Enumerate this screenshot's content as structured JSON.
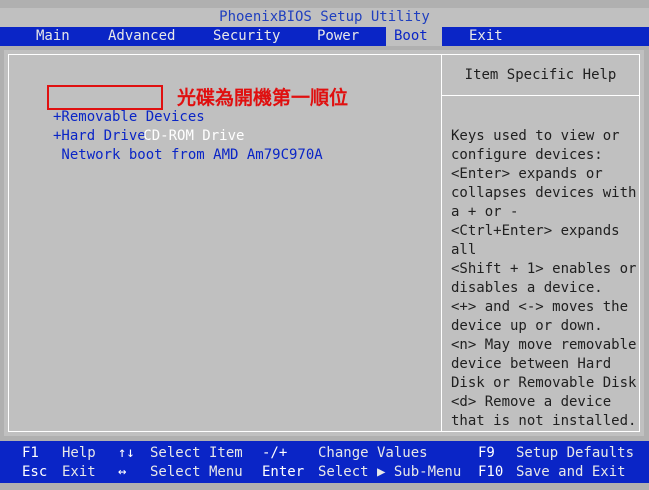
{
  "title": "PhoenixBIOS Setup Utility",
  "menu": [
    "Main",
    "Advanced",
    "Security",
    "Power",
    "Boot",
    "Exit"
  ],
  "active_menu": "Boot",
  "boot_items": [
    "CD-ROM Drive",
    "+Removable Devices",
    "+Hard Drive",
    " Network boot from AMD Am79C970A"
  ],
  "annotation": "光碟為開機第一順位",
  "help": {
    "title": "Item Specific Help",
    "lines": [
      "Keys used to view or",
      "configure devices:",
      "<Enter> expands or",
      "collapses devices with",
      "a + or -",
      "<Ctrl+Enter> expands",
      "all",
      "<Shift + 1> enables or",
      "disables a device.",
      "<+> and <-> moves the",
      "device up or down.",
      "<n> May move removable",
      "device between Hard",
      "Disk or Removable Disk",
      "<d> Remove a device",
      "that is not installed."
    ]
  },
  "footer": {
    "row1": [
      {
        "key": "F1",
        "label": "Help"
      },
      {
        "key": "↑↓",
        "label": "Select Item"
      },
      {
        "key": "-/+",
        "label": "Change Values"
      },
      {
        "key": "F9",
        "label": "Setup Defaults"
      }
    ],
    "row2": [
      {
        "key": "Esc",
        "label": "Exit"
      },
      {
        "key": "↔",
        "label": "Select Menu"
      },
      {
        "key": "Enter",
        "label": "Select ▶ Sub-Menu"
      },
      {
        "key": "F10",
        "label": "Save and Exit"
      }
    ]
  },
  "colors": {
    "bios_blue": "#0a25c6",
    "panel_gray": "#c0c0c0",
    "annotation_red": "#e01010"
  }
}
